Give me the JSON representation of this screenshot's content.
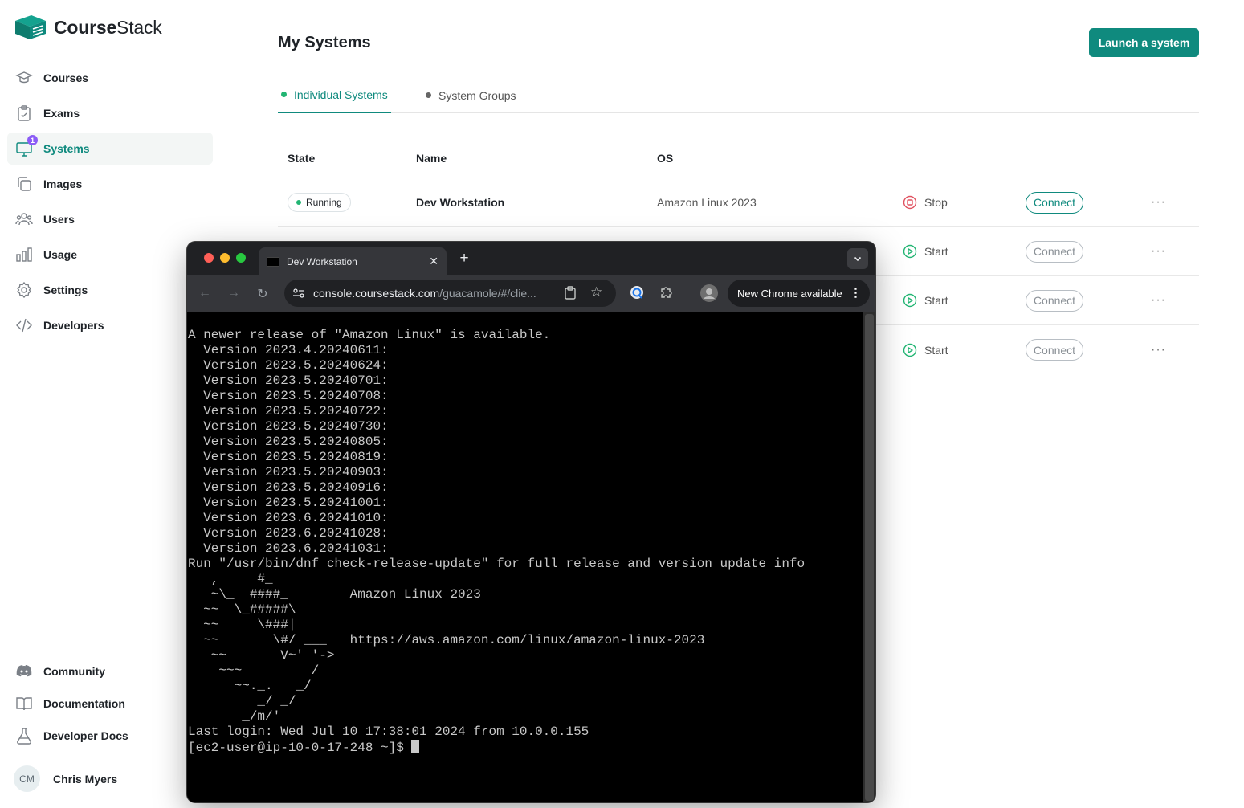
{
  "app": {
    "brand_first": "Course",
    "brand_second": "Stack"
  },
  "sidebar": {
    "items": [
      {
        "label": "Courses",
        "icon": "graduation-cap-icon"
      },
      {
        "label": "Exams",
        "icon": "clipboard-icon"
      },
      {
        "label": "Systems",
        "icon": "monitor-icon",
        "badge": "1"
      },
      {
        "label": "Images",
        "icon": "copy-icon"
      },
      {
        "label": "Users",
        "icon": "users-icon"
      },
      {
        "label": "Usage",
        "icon": "bar-chart-icon"
      },
      {
        "label": "Settings",
        "icon": "gear-icon"
      },
      {
        "label": "Developers",
        "icon": "code-icon"
      }
    ],
    "bottom": [
      {
        "label": "Community",
        "icon": "discord-icon"
      },
      {
        "label": "Documentation",
        "icon": "book-icon"
      },
      {
        "label": "Developer Docs",
        "icon": "flask-icon"
      }
    ],
    "user": {
      "initials": "CM",
      "name": "Chris Myers"
    }
  },
  "main": {
    "title": "My Systems",
    "launch_label": "Launch a system",
    "tabs": [
      {
        "label": "Individual Systems"
      },
      {
        "label": "System Groups"
      }
    ],
    "columns": {
      "state": "State",
      "name": "Name",
      "os": "OS"
    },
    "rows": [
      {
        "state": "Running",
        "name": "Dev Workstation",
        "os": "Amazon Linux 2023",
        "action": "Stop",
        "connect": "Connect",
        "more": "···"
      },
      {
        "action": "Start",
        "connect": "Connect",
        "more": "···"
      },
      {
        "action": "Start",
        "connect": "Connect",
        "more": "···"
      },
      {
        "action": "Start",
        "connect": "Connect",
        "more": "···"
      }
    ]
  },
  "browser": {
    "tab_title": "Dev Workstation",
    "url_host": "console.coursestack.com",
    "url_path": "/guacamole/#/clie...",
    "update_label": "New Chrome available"
  },
  "terminal": {
    "lines": [
      "A newer release of \"Amazon Linux\" is available.",
      "  Version 2023.4.20240611:",
      "  Version 2023.5.20240624:",
      "  Version 2023.5.20240701:",
      "  Version 2023.5.20240708:",
      "  Version 2023.5.20240722:",
      "  Version 2023.5.20240730:",
      "  Version 2023.5.20240805:",
      "  Version 2023.5.20240819:",
      "  Version 2023.5.20240903:",
      "  Version 2023.5.20240916:",
      "  Version 2023.5.20241001:",
      "  Version 2023.6.20241010:",
      "  Version 2023.6.20241028:",
      "  Version 2023.6.20241031:",
      "Run \"/usr/bin/dnf check-release-update\" for full release and version update info",
      "   ,     #_",
      "   ~\\_  ####_        Amazon Linux 2023",
      "  ~~  \\_#####\\",
      "  ~~     \\###|",
      "  ~~       \\#/ ___   https://aws.amazon.com/linux/amazon-linux-2023",
      "   ~~       V~' '->",
      "    ~~~         /",
      "      ~~._.   _/",
      "         _/ _/",
      "       _/m/'",
      "Last login: Wed Jul 10 17:38:01 2024 from 10.0.0.155"
    ],
    "prompt": "[ec2-user@ip-10-0-17-248 ~]$ "
  }
}
